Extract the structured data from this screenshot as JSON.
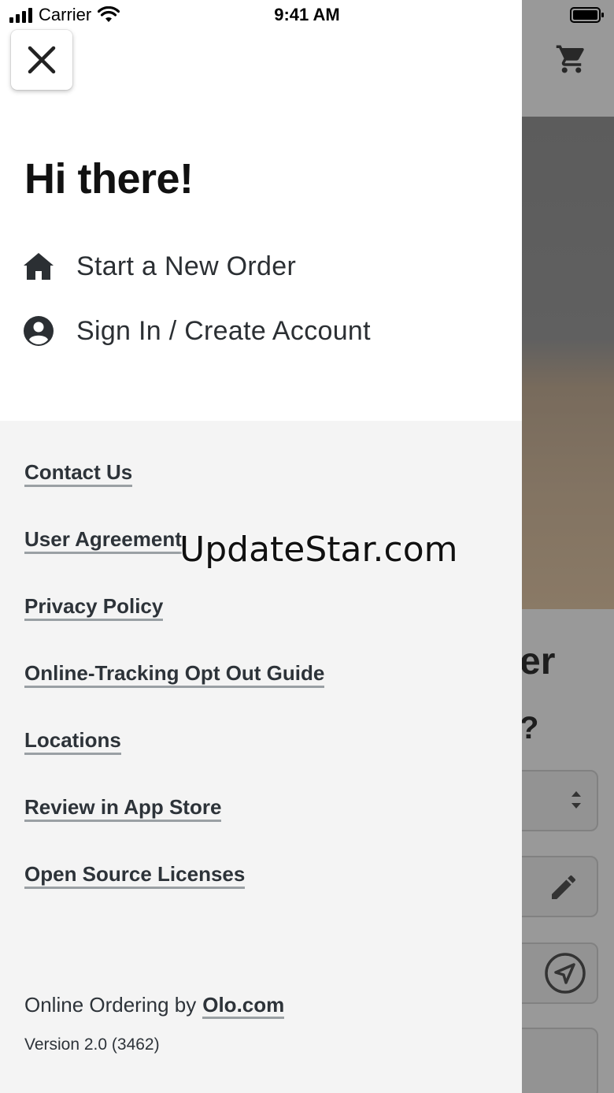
{
  "status_bar": {
    "carrier": "Carrier",
    "time": "9:41 AM"
  },
  "background": {
    "heading_fragment": "er",
    "question_fragment": "?"
  },
  "drawer": {
    "greeting": "Hi there!",
    "menu": [
      {
        "label": "Start a New Order",
        "icon": "home-icon"
      },
      {
        "label": "Sign In / Create Account",
        "icon": "account-circle-icon"
      }
    ],
    "links": [
      "Contact Us",
      "User Agreement",
      "Privacy Policy",
      "Online-Tracking Opt Out Guide",
      "Locations",
      "Review in App Store",
      "Open Source Licenses"
    ],
    "footer": {
      "prefix": "Online Ordering by",
      "link": "Olo.com",
      "version": "Version 2.0 (3462)"
    }
  },
  "watermark": "UpdateStar.com",
  "colors": {
    "drawer_top": "#ffffff",
    "drawer_bottom": "#f4f4f4",
    "text": "#2d3339",
    "link_underline": "#9aa0a4"
  }
}
